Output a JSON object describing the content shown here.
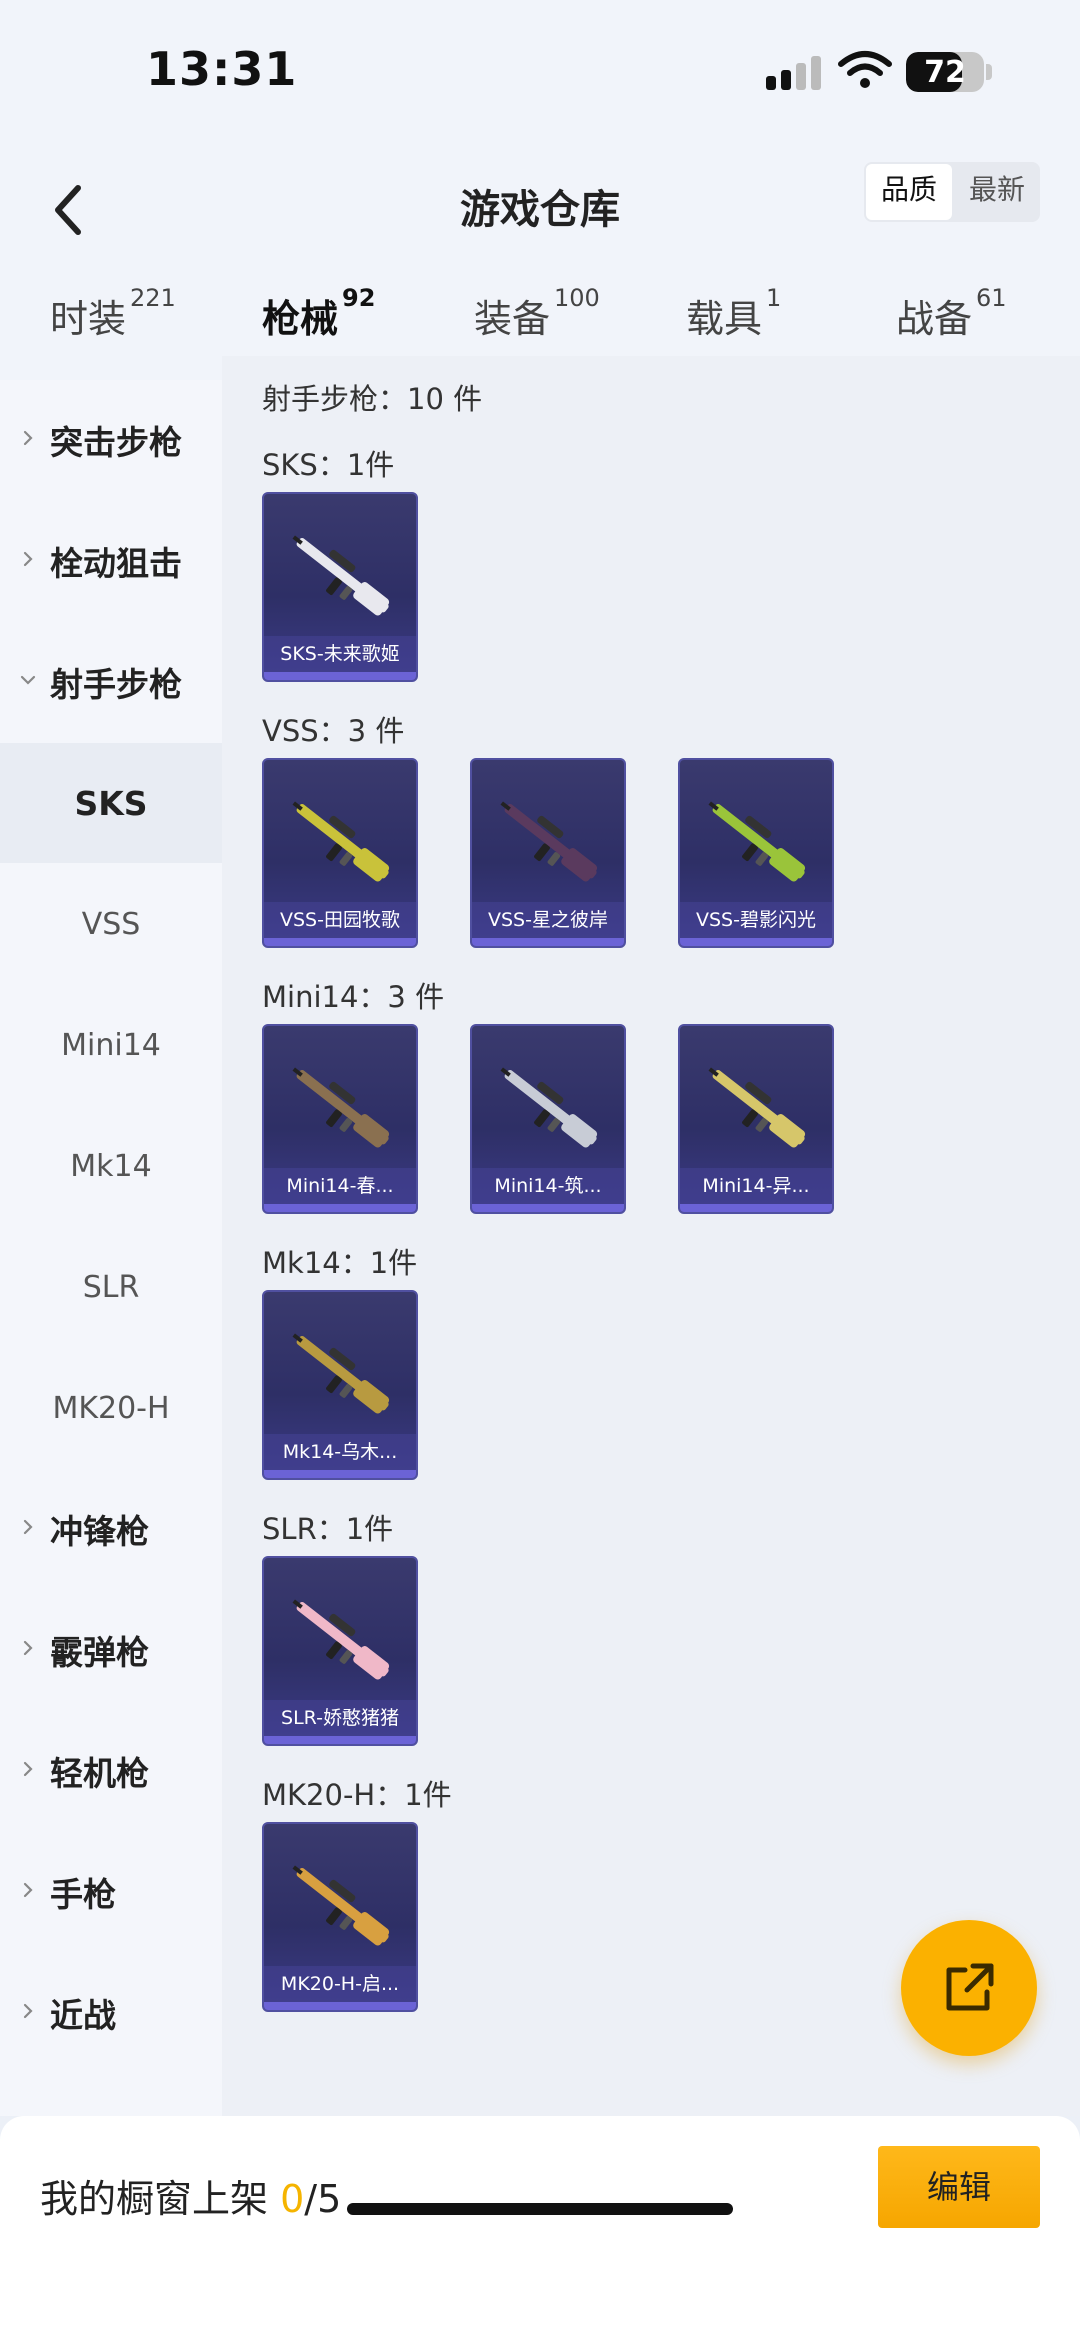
{
  "status": {
    "time": "13:31",
    "battery": "72",
    "battery_level": 0.72
  },
  "header": {
    "title": "游戏仓库",
    "sort": [
      "品质",
      "最新"
    ],
    "tabs": [
      {
        "label": "时装",
        "count": "221"
      },
      {
        "label": "枪械",
        "count": "92"
      },
      {
        "label": "装备",
        "count": "100"
      },
      {
        "label": "载具",
        "count": "1"
      },
      {
        "label": "战备",
        "count": "61"
      }
    ],
    "active_tab": "枪械"
  },
  "sidebar": {
    "items": [
      {
        "label": "突击步枪",
        "type": "category"
      },
      {
        "label": "栓动狙击",
        "type": "category"
      },
      {
        "label": "射手步枪",
        "type": "category",
        "expanded": true
      },
      {
        "label": "SKS",
        "type": "sub",
        "active": true
      },
      {
        "label": "VSS",
        "type": "sub"
      },
      {
        "label": "Mini14",
        "type": "sub"
      },
      {
        "label": "Mk14",
        "type": "sub"
      },
      {
        "label": "SLR",
        "type": "sub"
      },
      {
        "label": "MK20-H",
        "type": "sub"
      },
      {
        "label": "冲锋枪",
        "type": "category"
      },
      {
        "label": "霰弹枪",
        "type": "category"
      },
      {
        "label": "轻机枪",
        "type": "category"
      },
      {
        "label": "手枪",
        "type": "category"
      },
      {
        "label": "近战",
        "type": "category"
      }
    ]
  },
  "content": {
    "summary": "射手步枪：10 件",
    "sections": [
      {
        "title": "SKS：1件",
        "items": [
          {
            "label": "SKS-未来歌姬",
            "color": "#e8e8ee"
          }
        ]
      },
      {
        "title": "VSS：3 件",
        "items": [
          {
            "label": "VSS-田园牧歌",
            "color": "#c9c23a"
          },
          {
            "label": "VSS-星之彼岸",
            "color": "#5a3a5e"
          },
          {
            "label": "VSS-碧影闪光",
            "color": "#9ac43a"
          }
        ]
      },
      {
        "title": "Mini14：3 件",
        "items": [
          {
            "label": "Mini14-春...",
            "color": "#8a7050"
          },
          {
            "label": "Mini14-筑...",
            "color": "#c8ccd6"
          },
          {
            "label": "Mini14-异...",
            "color": "#d6c66a"
          }
        ]
      },
      {
        "title": "Mk14：1件",
        "items": [
          {
            "label": "Mk14-乌木...",
            "color": "#b89a40"
          }
        ]
      },
      {
        "title": "SLR：1件",
        "items": [
          {
            "label": "SLR-娇憨猪猪",
            "color": "#f0b8c8"
          }
        ]
      },
      {
        "title": "MK20-H：1件",
        "items": [
          {
            "label": "MK20-H-启...",
            "color": "#d8a040"
          }
        ]
      }
    ]
  },
  "footer": {
    "shelf_prefix": "我的橱窗上架 ",
    "shelf_current": "0",
    "shelf_total": "/5",
    "edit_label": "编辑"
  },
  "colors": {
    "accent": "#fbb300",
    "card": "#2e2f66"
  }
}
